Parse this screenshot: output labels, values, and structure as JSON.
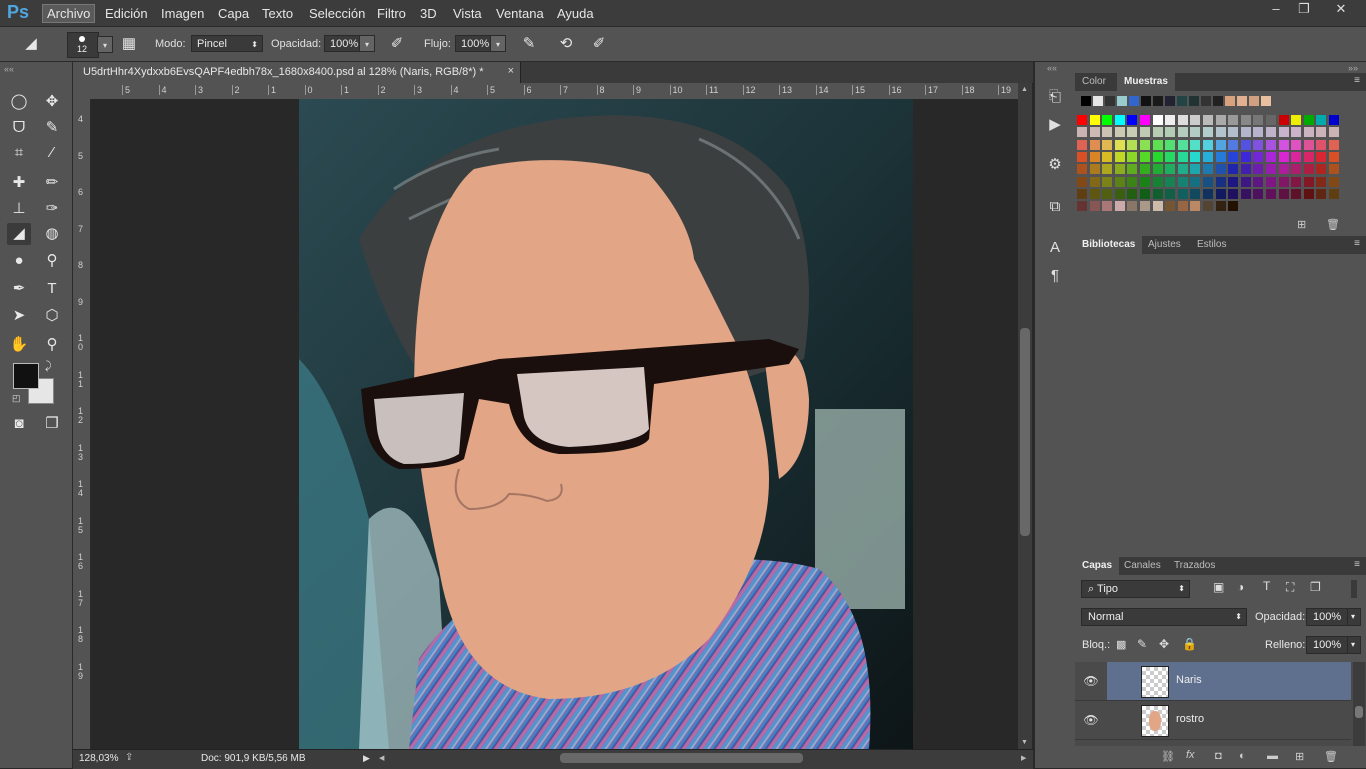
{
  "app": {
    "logo": "Ps"
  },
  "menu": [
    "Archivo",
    "Edición",
    "Imagen",
    "Capa",
    "Texto",
    "Selección",
    "Filtro",
    "3D",
    "Vista",
    "Ventana",
    "Ayuda"
  ],
  "window_controls": {
    "minimize": "–",
    "restore": "❐",
    "close": "✕"
  },
  "options": {
    "brush_size": "12",
    "mode_label": "Modo:",
    "mode_value": "Pincel",
    "opacity_label": "Opacidad:",
    "opacity_value": "100%",
    "flow_label": "Flujo:",
    "flow_value": "100%"
  },
  "document": {
    "title": "U5drtHhr4Xydxxb6EvsQAPF4edbh78x_1680x8400.psd al 128% (Naris, RGB/8*) *",
    "close": "×"
  },
  "ruler": {
    "top": [
      "5",
      "4",
      "3",
      "2",
      "1",
      "0",
      "1",
      "2",
      "3",
      "4",
      "5",
      "6",
      "7",
      "8",
      "9",
      "10",
      "11",
      "12",
      "13",
      "14",
      "15",
      "16",
      "17",
      "18",
      "19"
    ],
    "left": [
      "4",
      "5",
      "6",
      "7",
      "8",
      "9",
      "1\n0",
      "1\n1",
      "1\n2",
      "1\n3",
      "1\n4",
      "1\n5",
      "1\n6",
      "1\n7",
      "1\n8",
      "1\n9"
    ]
  },
  "status": {
    "zoom": "128,03%",
    "doc": "Doc: 901,9 KB/5,56 MB"
  },
  "panels": {
    "top_tabs": [
      "Color",
      "Muestras"
    ],
    "mid_tabs": [
      "Bibliotecas",
      "Ajustes",
      "Estilos"
    ],
    "layer_tabs": [
      "Capas",
      "Canales",
      "Trazados"
    ],
    "filter_kind": "Tipo",
    "blend_mode": "Normal",
    "opacity_label": "Opacidad:",
    "opacity_value": "100%",
    "lock_label": "Bloq.:",
    "fill_label": "Relleno:",
    "fill_value": "100%"
  },
  "layers": [
    {
      "name": "Naris",
      "selected": true
    },
    {
      "name": "rostro",
      "selected": false
    }
  ],
  "colors": {
    "accent": "#4fa6e0",
    "skin": "#e2a586",
    "selected_layer": "#5f6f8e",
    "foreground": "#111111",
    "background": "#e6e6e6"
  }
}
